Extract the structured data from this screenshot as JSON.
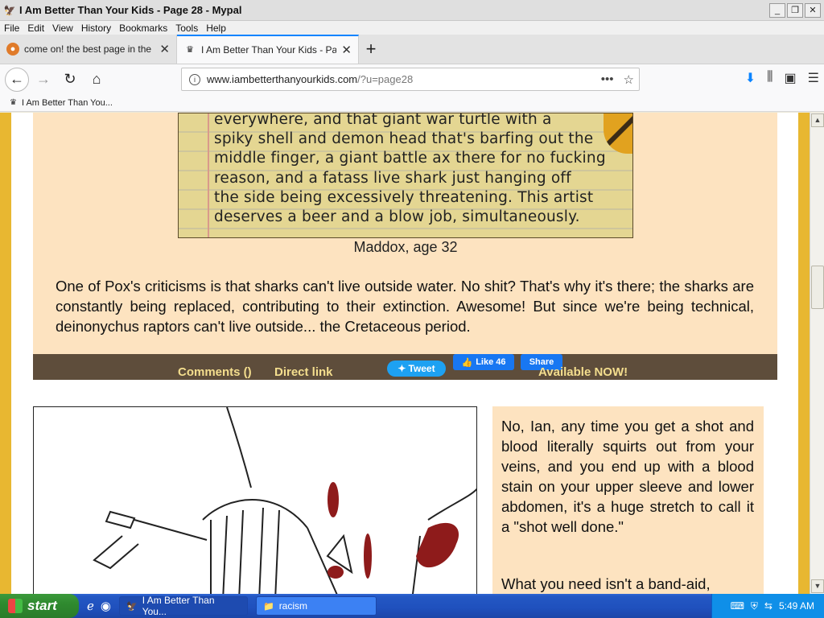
{
  "window": {
    "title": "I Am Better Than Your Kids - Page 28 - Mypal",
    "min_label": "_",
    "max_label": "❐",
    "close_label": "✕"
  },
  "menu": [
    "File",
    "Edit",
    "View",
    "History",
    "Bookmarks",
    "Tools",
    "Help"
  ],
  "tabs": [
    {
      "label": "come on! the best page in the uni",
      "active": false
    },
    {
      "label": "I Am Better Than Your Kids - Page",
      "active": true
    }
  ],
  "newtab_label": "+",
  "urlbar": {
    "host": "www.iambetterthanyourkids.com",
    "path": "/?u=page28"
  },
  "bookmarks": [
    {
      "label": "I Am Better Than You..."
    }
  ],
  "post1": {
    "handwriting": [
      "everywhere, and that giant war turtle with a",
      "spiky shell and demon head that's barfing out the",
      "middle finger, a giant battle ax there for no fucking",
      "reason, and a fatass live shark just hanging off",
      "the side being excessively threatening. This artist",
      "deserves a beer and a blow job, simultaneously."
    ],
    "caption": "Maddox, age 32",
    "body": "One of Pox's criticisms is that sharks can't live outside water. No shit? That's why it's there; the sharks are constantly being replaced, contributing to their extinction. Awesome! But since we're being technical, deinonychus raptors can't live outside... the Cretaceous period."
  },
  "footer": {
    "comments": "Comments ()",
    "direct_link": "Direct link",
    "tweet": "Tweet",
    "like": "Like 46",
    "share": "Share",
    "available": "Available NOW!"
  },
  "post2": {
    "text1": "No, Ian, any time you get a shot and blood literally squirts out from your veins, and you end up with a blood stain on your upper sleeve and lower abdomen, it's a huge stretch to call it a \"shot well done.\"",
    "text2": "What you need isn't a band-aid,"
  },
  "taskbar": {
    "start": "start",
    "tasks": [
      {
        "label": "I Am Better Than You...",
        "active": true
      },
      {
        "label": "racism",
        "active": false
      }
    ],
    "clock": "5:49 AM"
  },
  "colors": {
    "gold": "#e8b731",
    "post_bg": "#fde3c0",
    "footer_bg": "#5e4d3b",
    "footer_link": "#f4de8e",
    "tweet": "#1da1f2",
    "facebook": "#1877f2"
  }
}
